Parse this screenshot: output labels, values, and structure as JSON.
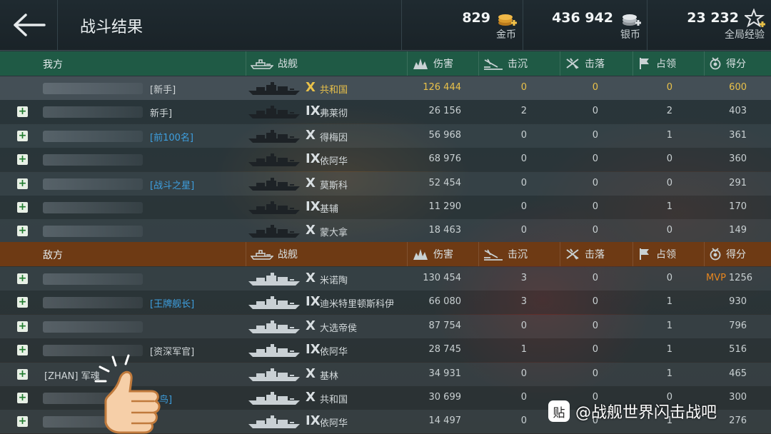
{
  "header": {
    "title": "战斗结果",
    "resources": [
      {
        "value": "829",
        "label": "金币",
        "icon": "gold-coin-icon",
        "color": "#e0a030"
      },
      {
        "value": "436 942",
        "label": "银币",
        "icon": "silver-coin-icon",
        "color": "#c8ccd0"
      },
      {
        "value": "23 232",
        "label": "全局经验",
        "icon": "star-xp-icon",
        "color": "#d8dadc"
      }
    ]
  },
  "columns": {
    "ship": "战舰",
    "damage": "伤害",
    "sunk": "击沉",
    "shot_down": "击落",
    "capture": "占领",
    "score": "得分"
  },
  "allies": {
    "team_label": "我方",
    "header_color": "#1f5a45",
    "rows": [
      {
        "name": "",
        "title": "[新手]",
        "title_color": "#d0d6d8",
        "tier": "X",
        "ship": "共和国",
        "damage": "126 444",
        "sunk": "0",
        "shot_down": "0",
        "capture": "0",
        "score": "600",
        "highlight": true
      },
      {
        "name": "",
        "title": "新手]",
        "title_color": "#d0d6d8",
        "tier": "IX",
        "ship": "弗莱彻",
        "damage": "26 156",
        "sunk": "2",
        "shot_down": "0",
        "capture": "2",
        "score": "403"
      },
      {
        "name": "",
        "title": "[前100名]",
        "title_color": "#3ea0e0",
        "tier": "X",
        "ship": "得梅因",
        "damage": "56 968",
        "sunk": "0",
        "shot_down": "0",
        "capture": "1",
        "score": "361"
      },
      {
        "name": "",
        "title": "",
        "title_color": "#d0d6d8",
        "tier": "IX",
        "ship": "依阿华",
        "damage": "68 976",
        "sunk": "0",
        "shot_down": "0",
        "capture": "0",
        "score": "360"
      },
      {
        "name": "",
        "title": "[战斗之星]",
        "title_color": "#3ea0e0",
        "tier": "X",
        "ship": "莫斯科",
        "damage": "52 454",
        "sunk": "0",
        "shot_down": "0",
        "capture": "0",
        "score": "291"
      },
      {
        "name": "",
        "title": "",
        "title_color": "#d0d6d8",
        "tier": "IX",
        "ship": "基辅",
        "damage": "11 290",
        "sunk": "0",
        "shot_down": "0",
        "capture": "1",
        "score": "170"
      },
      {
        "name": "",
        "title": "",
        "title_color": "#d0d6d8",
        "tier": "X",
        "ship": "蒙大拿",
        "damage": "18 463",
        "sunk": "0",
        "shot_down": "0",
        "capture": "0",
        "score": "149"
      }
    ]
  },
  "enemies": {
    "team_label": "敌方",
    "header_color": "#6e3a14",
    "rows": [
      {
        "name": "",
        "title": "",
        "title_color": "#d0d6d8",
        "tier": "X",
        "ship": "米诺陶",
        "damage": "130 454",
        "sunk": "3",
        "shot_down": "0",
        "capture": "0",
        "score": "1256",
        "mvp": "MVP"
      },
      {
        "name": "",
        "title": "[王牌舰长]",
        "title_color": "#3ea0e0",
        "tier": "IX",
        "ship": "迪米特里顿斯科伊",
        "damage": "66 080",
        "sunk": "3",
        "shot_down": "0",
        "capture": "1",
        "score": "930"
      },
      {
        "name": "",
        "title": "",
        "title_color": "#d0d6d8",
        "tier": "X",
        "ship": "大选帝侯",
        "damage": "87 754",
        "sunk": "0",
        "shot_down": "0",
        "capture": "1",
        "score": "796"
      },
      {
        "name": "",
        "title": "[资深军官]",
        "title_color": "#d0d6d8",
        "tier": "IX",
        "ship": "依阿华",
        "damage": "28 745",
        "sunk": "1",
        "shot_down": "0",
        "capture": "1",
        "score": "516"
      },
      {
        "name": "[ZHAN] 军魂",
        "title": "",
        "title_color": "#d0d6d8",
        "tier": "X",
        "ship": "基林",
        "damage": "34 931",
        "sunk": "0",
        "shot_down": "0",
        "capture": "1",
        "score": "465"
      },
      {
        "name": "",
        "title": "死鸟]",
        "title_color": "#3ea0e0",
        "tier": "X",
        "ship": "共和国",
        "damage": "30 699",
        "sunk": "0",
        "shot_down": "0",
        "capture": "0",
        "score": "300"
      },
      {
        "name": "",
        "title": "",
        "title_color": "#d0d6d8",
        "tier": "IX",
        "ship": "依阿华",
        "damage": "14 497",
        "sunk": "0",
        "shot_down": "0",
        "capture": "1",
        "score": "276"
      }
    ]
  },
  "watermark": {
    "badge": "贴",
    "text": "@战舰世界闪击战吧"
  }
}
